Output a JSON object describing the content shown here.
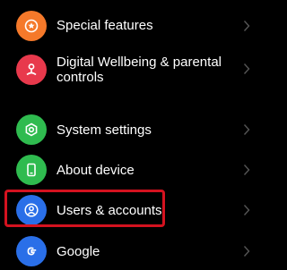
{
  "settings": {
    "items": [
      {
        "label": "Special features",
        "icon": "star-gear-icon",
        "color": "#f5792a"
      },
      {
        "label": "Digital Wellbeing & parental",
        "label_line2": "controls",
        "icon": "wellbeing-person-icon",
        "color": "#e8394c"
      },
      {
        "label": "System settings",
        "icon": "gear-hexagon-icon",
        "color": "#2fbb4f"
      },
      {
        "label": "About device",
        "icon": "phone-icon",
        "color": "#2fbb4f"
      },
      {
        "label": "Users & accounts",
        "icon": "user-icon",
        "color": "#2a6fe8"
      },
      {
        "label": "Google",
        "icon": "google-icon",
        "color": "#2a6fe8"
      }
    ]
  },
  "highlight_color": "#d4121f"
}
